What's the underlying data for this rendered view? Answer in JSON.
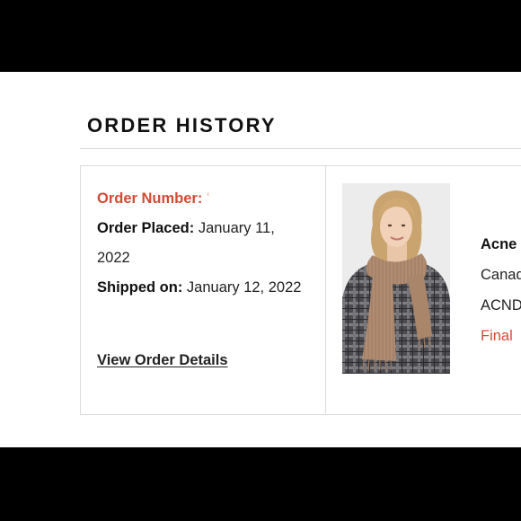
{
  "page": {
    "title": "ORDER HISTORY"
  },
  "order": {
    "number_label": "Order Number:",
    "number_value": "'",
    "placed_label": "Order Placed:",
    "placed_value": "January 11, 2022",
    "shipped_label": "Shipped on:",
    "shipped_value": "January 12, 2022",
    "view_details_label": "View Order Details"
  },
  "product": {
    "brand": "Acne",
    "line2": "Canad",
    "line3": "ACND",
    "status": "Final"
  },
  "colors": {
    "accent_red": "#d24b34",
    "text": "#222222",
    "border": "#dcdcdc",
    "letterbox": "#000000"
  }
}
